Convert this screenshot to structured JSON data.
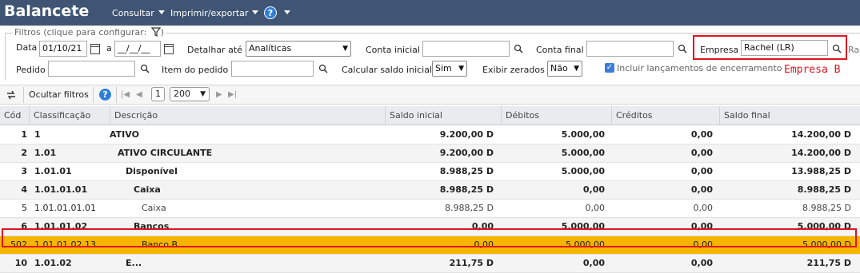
{
  "header": {
    "title": "Balancete",
    "menus": [
      "Consultar",
      "Imprimir/exportar"
    ],
    "help": "?"
  },
  "filters": {
    "legend": "Filtros (clique para configurar:",
    "data_label": "Data",
    "data_from": "01/10/21",
    "data_sep": "a",
    "data_to": "__/__/__",
    "detalhar_label": "Detalhar até",
    "detalhar_value": "Analíticas",
    "conta_inicial_label": "Conta inicial",
    "conta_final_label": "Conta final",
    "empresa_label": "Empresa",
    "empresa_value": "Rachel (LR)",
    "empresa_overflow": "Rac",
    "pedido_label": "Pedido",
    "item_label": "Item do pedido",
    "saldo_inicial_label": "Calcular saldo inicial",
    "saldo_inicial_value": "Sim",
    "exibir_zerados_label": "Exibir zerados",
    "exibir_zerados_value": "Não",
    "incluir_label": "Incluir lançamentos de encerramento",
    "annotation": "Empresa B"
  },
  "toolbar": {
    "hide_filters": "Ocultar filtros",
    "page": "1",
    "page_size": "200",
    "help": "?"
  },
  "table": {
    "columns": [
      "Cód",
      "Classificação",
      "Descrição",
      "Saldo inicial",
      "Débitos",
      "Créditos",
      "Saldo final"
    ],
    "rows": [
      {
        "cod": "1",
        "class": "1",
        "desc": "ATIVO",
        "saldo_inicial": "9.200,00 D",
        "debitos": "5.000,00",
        "creditos": "0,00",
        "saldo_final": "14.200,00 D",
        "bold": true,
        "indent": 0
      },
      {
        "cod": "2",
        "class": "1.01",
        "desc": "ATIVO CIRCULANTE",
        "saldo_inicial": "9.200,00 D",
        "debitos": "5.000,00",
        "creditos": "0,00",
        "saldo_final": "14.200,00 D",
        "bold": true,
        "indent": 1
      },
      {
        "cod": "3",
        "class": "1.01.01",
        "desc": "Disponível",
        "saldo_inicial": "8.988,25 D",
        "debitos": "5.000,00",
        "creditos": "0,00",
        "saldo_final": "13.988,25 D",
        "bold": true,
        "indent": 2
      },
      {
        "cod": "4",
        "class": "1.01.01.01",
        "desc": "Caixa",
        "saldo_inicial": "8.988,25 D",
        "debitos": "0,00",
        "creditos": "0,00",
        "saldo_final": "8.988,25 D",
        "bold": true,
        "indent": 3
      },
      {
        "cod": "5",
        "class": "1.01.01.01.01",
        "desc": "Caixa",
        "saldo_inicial": "8.988,25 D",
        "debitos": "0,00",
        "creditos": "0,00",
        "saldo_final": "8.988,25 D",
        "bold": false,
        "indent": 4
      },
      {
        "cod": "6",
        "class": "1.01.01.02",
        "desc": "Bancos",
        "saldo_inicial": "0,00",
        "debitos": "5.000,00",
        "creditos": "0,00",
        "saldo_final": "5.000,00 D",
        "bold": true,
        "indent": 3
      },
      {
        "cod": "502",
        "class": "1.01.01.02.13",
        "desc": "Banco B",
        "saldo_inicial": "0,00",
        "debitos": "5.000,00",
        "creditos": "0,00",
        "saldo_final": "5.000,00 D",
        "bold": false,
        "indent": 4,
        "highlight": true
      },
      {
        "cod": "10",
        "class": "1.01.02",
        "desc": "E...",
        "saldo_inicial": "211,75 D",
        "debitos": "0,00",
        "creditos": "0,00",
        "saldo_final": "211,75 D",
        "bold": true,
        "indent": 2
      }
    ]
  }
}
